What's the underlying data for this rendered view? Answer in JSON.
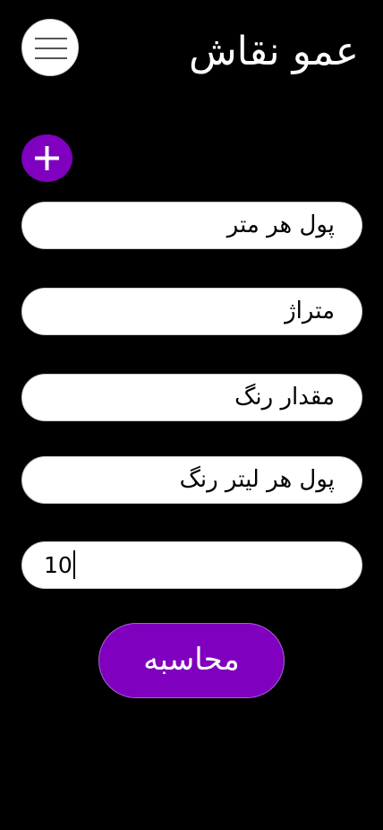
{
  "header": {
    "title": "عمو نقاش",
    "menu_icon": "hamburger-menu-icon"
  },
  "add_button": {
    "icon": "plus-icon"
  },
  "fields": {
    "price_per_meter": "پول هر متر",
    "area": "متراژ",
    "paint_amount": "مقدار رنگ",
    "price_per_liter": "پول هر لیتر رنگ",
    "active_input_value": "10"
  },
  "actions": {
    "calculate_label": "محاسبه"
  },
  "colors": {
    "background": "#000000",
    "accent": "#7f00bf",
    "field_background": "#ffffff"
  }
}
